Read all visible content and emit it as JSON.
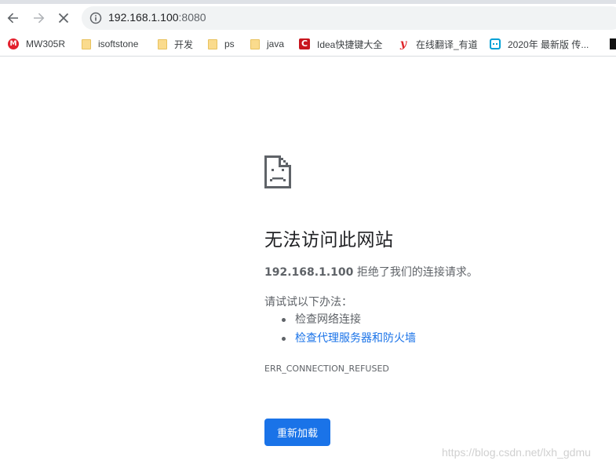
{
  "toolbar": {
    "back_icon": "arrow-left-icon",
    "forward_icon": "arrow-right-icon",
    "stop_icon": "close-icon",
    "info_icon": "info-icon",
    "url_host": "192.168.1.100",
    "url_port": ":8080"
  },
  "bookmarks": [
    {
      "label": "MW305R",
      "icon": "mercury-icon",
      "icon_text": "M"
    },
    {
      "label": "isoftstone",
      "icon": "folder-icon"
    },
    {
      "label": "开发",
      "icon": "folder-icon"
    },
    {
      "label": "ps",
      "icon": "folder-icon"
    },
    {
      "label": "java",
      "icon": "folder-icon"
    },
    {
      "label": "Idea快捷键大全",
      "icon": "csdn-icon",
      "icon_text": "C"
    },
    {
      "label": "在线翻译_有道",
      "icon": "youdao-icon",
      "icon_text": "y"
    },
    {
      "label": "2020年 最新版 传...",
      "icon": "bilibili-icon"
    }
  ],
  "error": {
    "icon": "sad-document-icon",
    "heading": "无法访问此网站",
    "host": "192.168.1.100",
    "description_suffix": " 拒绝了我们的连接请求。",
    "try_label": "请试试以下办法：",
    "suggestions": [
      {
        "label": "检查网络连接",
        "link": false
      },
      {
        "label": "检查代理服务器和防火墙",
        "link": true
      }
    ],
    "code": "ERR_CONNECTION_REFUSED",
    "reload_label": "重新加载"
  },
  "watermark": "https://blog.csdn.net/lxh_gdmu",
  "colors": {
    "accent": "#1a73e8",
    "text": "#5f6368",
    "heading": "#202124"
  }
}
